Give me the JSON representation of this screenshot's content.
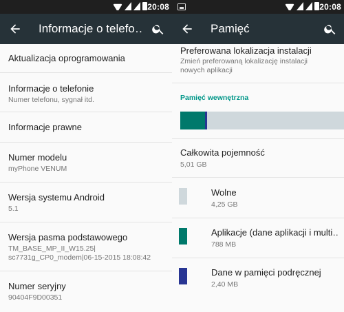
{
  "left": {
    "status": {
      "time": "20:08"
    },
    "appbar": {
      "title": "Informacje o telefo…"
    },
    "rows": [
      {
        "title": "Aktualizacja oprogramowania",
        "sub": ""
      },
      {
        "title": "Informacje o telefonie",
        "sub": "Numer telefonu, sygnał itd."
      },
      {
        "title": "Informacje prawne",
        "sub": ""
      },
      {
        "title": "Numer modelu",
        "sub": "myPhone VENUM"
      },
      {
        "title": "Wersja systemu Android",
        "sub": "5.1"
      },
      {
        "title": "Wersja pasma podstawowego",
        "sub": "TM_BASE_MP_II_W15.25|",
        "sub2": "sc7731g_CP0_modem|06-15-2015 18:08:42"
      },
      {
        "title": "Numer seryjny",
        "sub": "90404F9D00351"
      }
    ]
  },
  "right": {
    "status": {
      "time": "20:08"
    },
    "appbar": {
      "title": "Pamięć"
    },
    "install": {
      "title": "Preferowana lokalizacja instalacji",
      "sub": "Zmień preferowaną lokalizację instalacji nowych aplikacji"
    },
    "section": "Pamięć wewnętrzna",
    "usage": {
      "apps_fraction": 0.151,
      "cache_fraction": 0.013
    },
    "total": {
      "title": "Całkowita pojemność",
      "value": "5,01 GB"
    },
    "items": [
      {
        "label": "Wolne",
        "value": "4,25 GB",
        "color": "#cfd8dc"
      },
      {
        "label": "Aplikacje (dane aplikacji i multi…",
        "value": "788 MB",
        "color": "#00796b"
      },
      {
        "label": "Dane w pamięci podręcznej",
        "value": "2,40 MB",
        "color": "#283593"
      }
    ]
  }
}
